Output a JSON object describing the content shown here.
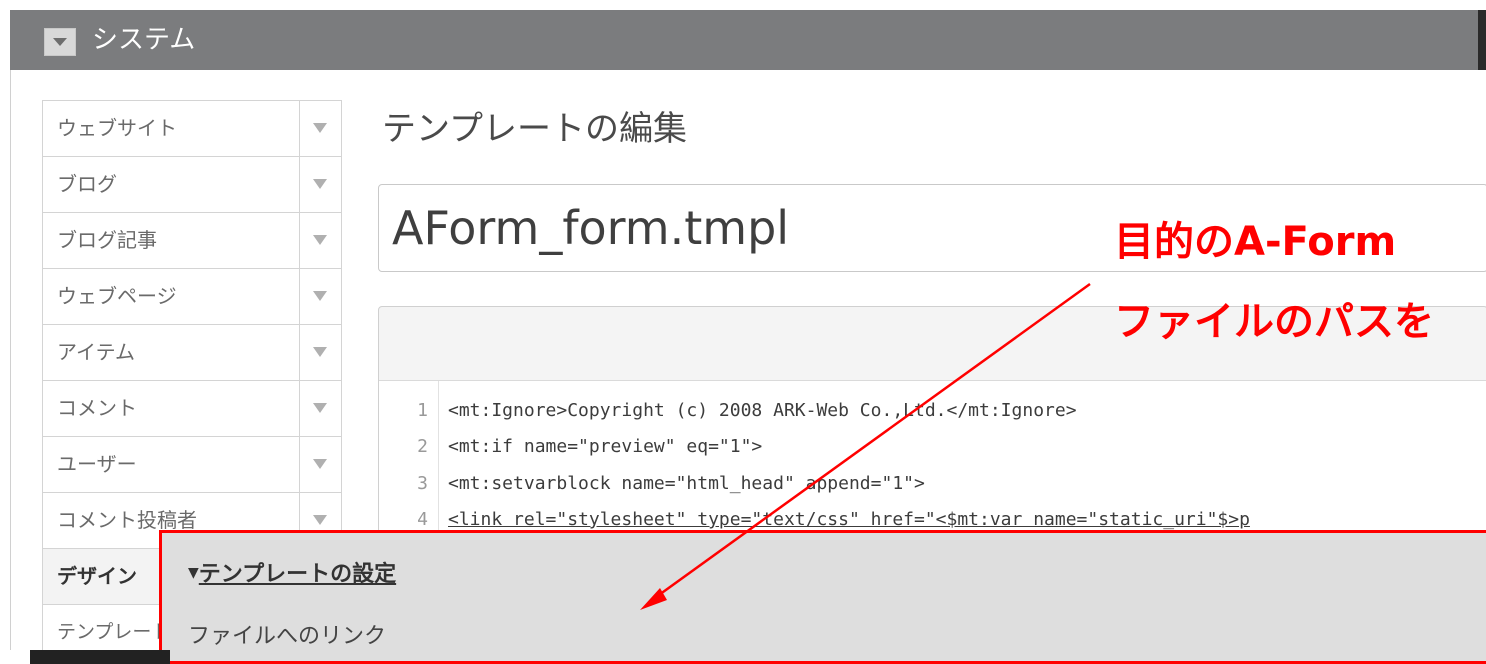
{
  "topbar": {
    "title": "システム"
  },
  "sidebar": {
    "items": [
      {
        "label": "ウェブサイト"
      },
      {
        "label": "ブログ"
      },
      {
        "label": "ブログ記事"
      },
      {
        "label": "ウェブページ"
      },
      {
        "label": "アイテム"
      },
      {
        "label": "コメント"
      },
      {
        "label": "ユーザー"
      },
      {
        "label": "コメント投稿者"
      },
      {
        "label": "デザイン"
      },
      {
        "label": "テンプレート"
      }
    ]
  },
  "main": {
    "page_title": "テンプレートの編集",
    "template_name": "AForm_form.tmpl",
    "code_lines": [
      {
        "num": "1",
        "text": "<mt:Ignore>Copyright (c) 2008 ARK-Web Co.,Ltd.</mt:Ignore>"
      },
      {
        "num": "2",
        "text": "<mt:if name=\"preview\" eq=\"1\">"
      },
      {
        "num": "3",
        "text": "<mt:setvarblock name=\"html_head\" append=\"1\">"
      },
      {
        "num": "4",
        "text": "<link rel=\"stylesheet\" type=\"text/css\" href=\"<$mt:var name=\"static_uri\"$>p"
      }
    ]
  },
  "annotation": {
    "line1": "目的のA-Form",
    "line2": "ファイルのパスを",
    "color": "#ff0000"
  },
  "settings": {
    "title": "テンプレートの設定",
    "field_label": "ファイルへのリンク"
  }
}
